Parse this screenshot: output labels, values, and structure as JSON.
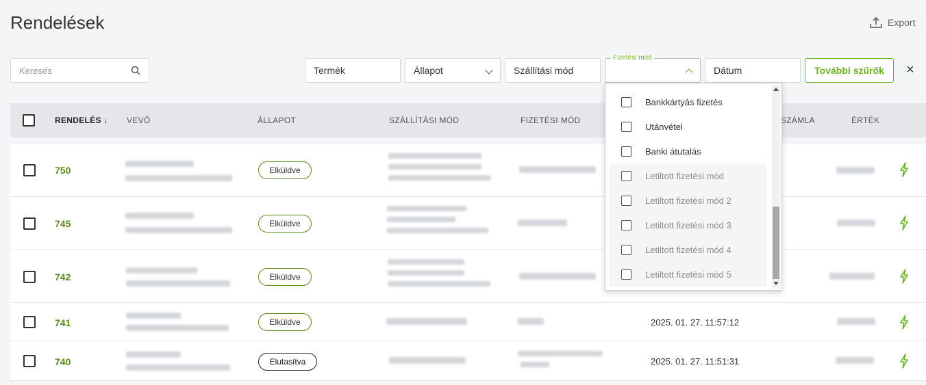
{
  "page": {
    "title": "Rendelések",
    "export_label": "Export"
  },
  "filters": {
    "search_placeholder": "Keresés",
    "product": "Termék",
    "status": "Állapot",
    "shipping": "Szállítási mód",
    "payment_label": "Fizetési mód",
    "date": "Dátum",
    "more_filters": "További szűrők",
    "close": "×"
  },
  "table": {
    "headers": {
      "order": "RENDELÉS",
      "sort_indicator": "↓",
      "customer": "VEVŐ",
      "status": "ÁLLAPOT",
      "shipping": "SZÁLLÍTÁSI MÓD",
      "payment": "FIZETÉSI MÓD",
      "invoice": "SZÁMLA",
      "value": "ÉRTÉK"
    },
    "rows": [
      {
        "order": "750",
        "status": "Elküldve",
        "date": ""
      },
      {
        "order": "745",
        "status": "Elküldve",
        "date": ""
      },
      {
        "order": "742",
        "status": "Elküldve",
        "date": ""
      },
      {
        "order": "741",
        "status": "Elküldve",
        "date": "2025. 01. 27. 11:57:12"
      },
      {
        "order": "740",
        "status": "Elutasítva",
        "date": "2025. 01. 27. 11:51:31"
      }
    ]
  },
  "payment_dropdown": {
    "options": [
      {
        "label": "Bankkártyás fizetés",
        "disabled": false
      },
      {
        "label": "Utánvétel",
        "disabled": false
      },
      {
        "label": "Banki átutalás",
        "disabled": false
      },
      {
        "label": "Letiltott fizetési mód",
        "disabled": true
      },
      {
        "label": "Letiltott fizetési mód 2",
        "disabled": true
      },
      {
        "label": "Letiltott fizetési mód 3",
        "disabled": true
      },
      {
        "label": "Letiltott fizetési mód 4",
        "disabled": true
      },
      {
        "label": "Letiltott fizetési mód 5",
        "disabled": true
      }
    ]
  },
  "colors": {
    "accent": "#6ab023",
    "order_number": "#5c8a1c",
    "header_bg": "#e4e6ea"
  },
  "icons": {
    "export": "upload-icon",
    "search": "search-icon",
    "action": "lightning-bolt-icon"
  }
}
